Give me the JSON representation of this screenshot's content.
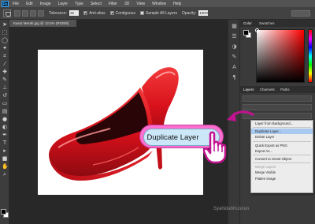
{
  "app": {
    "logo": "Ps"
  },
  "menu": [
    "File",
    "Edit",
    "Image",
    "Layer",
    "Type",
    "Select",
    "Filter",
    "3D",
    "View",
    "Window",
    "Help"
  ],
  "options": {
    "feather_label": "Tolerance:",
    "feather_value": "32",
    "anti_alias": "Anti-alias",
    "contiguous": "Contiguous",
    "sample_all": "Sample All Layers",
    "opacity_label": "Opacity:",
    "opacity_value": "100%"
  },
  "document": {
    "tab_title": "Kasut Merah.jpg @ 12.5% (RGB/8)"
  },
  "panels": {
    "color_tabs": [
      "Color",
      "Swatches"
    ],
    "layers_tabs": [
      "Layers",
      "Channels",
      "Paths"
    ]
  },
  "context_menu": {
    "items": [
      {
        "label": "Layer from Background...",
        "state": "normal"
      },
      {
        "label": "Duplicate Layer...",
        "state": "highlighted"
      },
      {
        "label": "Delete Layer",
        "state": "normal"
      },
      {
        "label": "Quick Export as PNG",
        "state": "normal"
      },
      {
        "label": "Export As...",
        "state": "normal"
      },
      {
        "label": "Convert to Smart Object",
        "state": "normal"
      },
      {
        "label": "Merge Layers",
        "state": "disabled"
      },
      {
        "label": "Merge Visible",
        "state": "normal"
      },
      {
        "label": "Flatten Image",
        "state": "normal"
      }
    ]
  },
  "callout": {
    "text": "Duplicate Layer"
  },
  "watermark": {
    "text": "SyahidahKusnun"
  },
  "colors": {
    "shoe_red": "#e0131f",
    "callout_pink": "#ff6fcf",
    "callout_fill": "#cce8f8",
    "arrow_magenta": "#c2128f"
  },
  "icons": [
    "photoshop-logo",
    "magic-wand-icon",
    "hand-cursor-icon",
    "curved-arrow-icon"
  ]
}
